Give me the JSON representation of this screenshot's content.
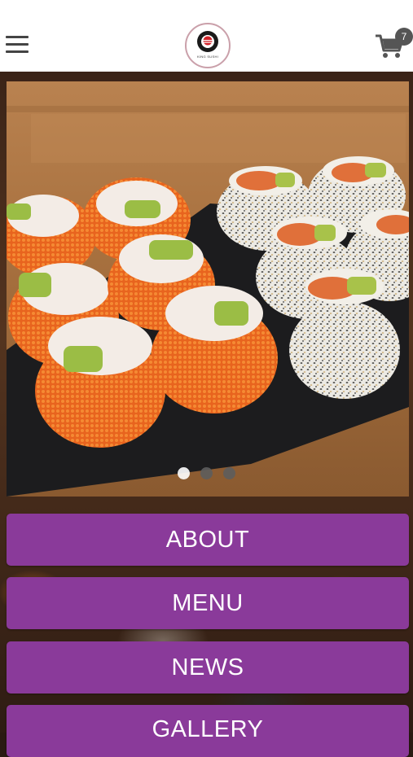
{
  "header": {
    "logo_text": "KING SUSHI",
    "cart_count": "7"
  },
  "slider": {
    "slides": 3,
    "active_index": 0
  },
  "nav": {
    "items": [
      {
        "label": "ABOUT"
      },
      {
        "label": "MENU"
      },
      {
        "label": "NEWS"
      },
      {
        "label": "GALLERY"
      }
    ]
  },
  "colors": {
    "accent": "#8a3a9a",
    "header_bg": "#ffffff",
    "brand_red": "#d2232a"
  },
  "icons": [
    "menu-icon",
    "cart-icon",
    "logo-mark"
  ]
}
